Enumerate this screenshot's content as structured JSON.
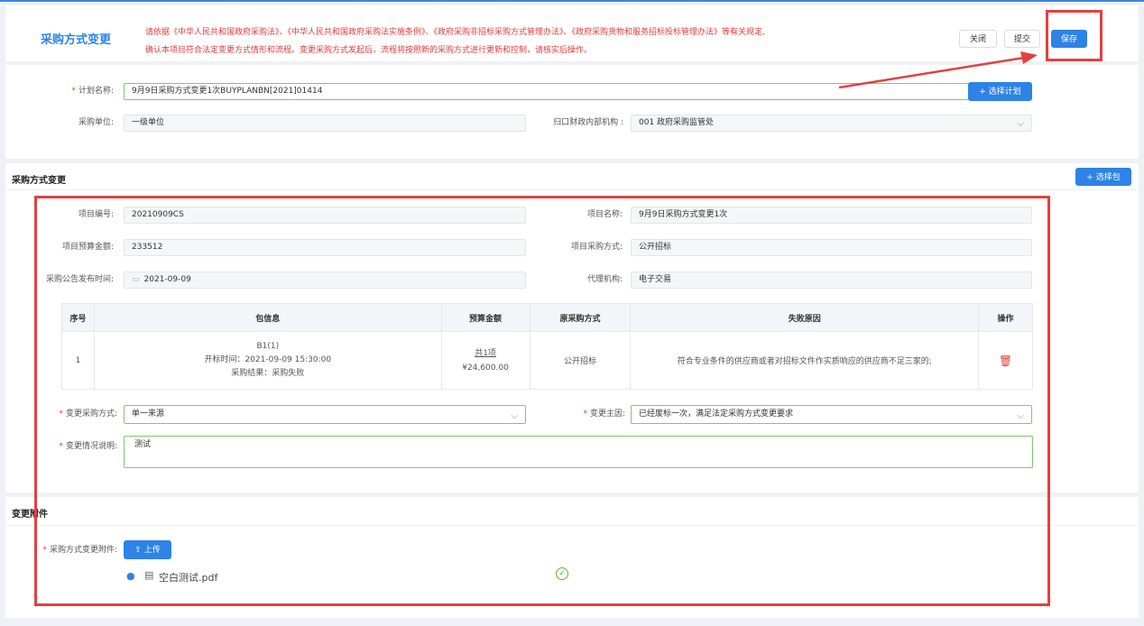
{
  "header": {
    "title": "采购方式变更",
    "notice_line1": "请依据《中华人民共和国政府采购法》、《中华人民共和国政府采购法实施条例》、《政府采购非招标采购方式管理办法》、《政府采购货物和服务招标投标管理办法》等有关规定,",
    "notice_line2": "确认本项目符合法定变更方式情形和流程。变更采购方式发起后，流程将按照新的采购方式进行更新和控制，请核实后操作。",
    "close_label": "关闭",
    "submit_label": "提交",
    "save_label": "保存"
  },
  "plan": {
    "name_label": "计划名称:",
    "name_value": "9月9日采购方式变更1次BUYPLANBN[2021]01414",
    "select_plan_label": "+ 选择计划",
    "unit_label": "采购单位:",
    "unit_value": "一级单位",
    "dept_label": "归口财政内部机构 :",
    "dept_value": "001  政府采购监管处"
  },
  "change": {
    "section_title": "采购方式变更",
    "select_pkg_label": "+ 选择包",
    "project_no_label": "项目编号:",
    "project_no_value": "20210909CS",
    "project_name_label": "项目名称:",
    "project_name_value": "9月9日采购方式变更1次",
    "budget_label": "项目预算金额:",
    "budget_value": "233512",
    "method_label": "项目采购方式:",
    "method_value": "公开招标",
    "publish_label": "采购公告发布时间:",
    "publish_value": "2021-09-09",
    "agency_label": "代理机构:",
    "agency_value": "电子交易",
    "table": {
      "headers": [
        "序号",
        "包信息",
        "预算金额",
        "原采购方式",
        "失败原因",
        "操作"
      ],
      "row": {
        "no": "1",
        "pkg_name": "B1(1)",
        "pkg_time": "开标时间：2021-09-09 15:30:00",
        "pkg_result": "采购结果：采购失败",
        "budget_link": "共1项",
        "budget_amount": "¥24,600.00",
        "orig_method": "公开招标",
        "fail_reason": "符合专业条件的供应商或者对招标文件作实质响应的供应商不足三家的;"
      }
    },
    "new_method_label": "变更采购方式:",
    "new_method_value": "单一来源",
    "reason_label": "变更主因:",
    "reason_value": "已经废标一次，满足法定采购方式变更要求",
    "desc_label": "变更情况说明:",
    "desc_value": "测试"
  },
  "attach": {
    "section_title": "变更附件",
    "label": "采购方式变更附件:",
    "upload_label": "上传",
    "file_name": "空白测试.pdf"
  },
  "colors": {
    "primary": "#2e82e8",
    "required": "#e23b3b",
    "notice": "#e23b3b",
    "highlight": "#e34040",
    "success": "#52c41a"
  }
}
